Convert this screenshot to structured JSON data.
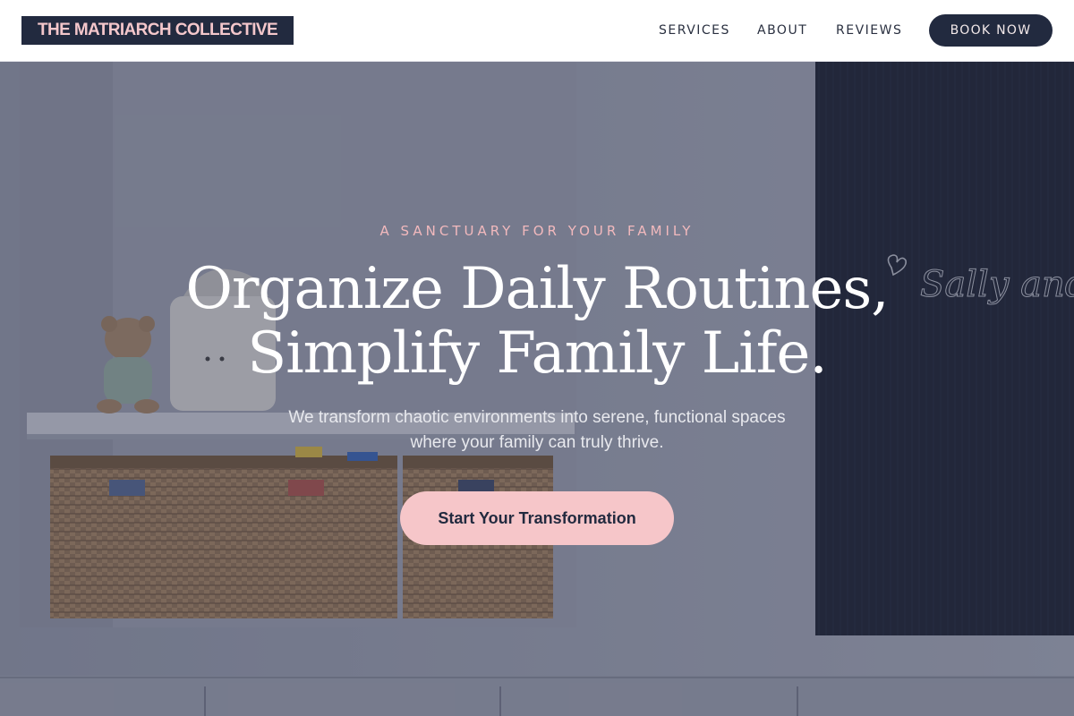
{
  "header": {
    "logo_text": "THE MATRIARCH COLLECTIVE",
    "nav": {
      "services": "SERVICES",
      "about": "ABOUT",
      "reviews": "REVIEWS"
    },
    "cta_label": "BOOK NOW"
  },
  "hero": {
    "eyebrow": "A SANCTUARY FOR YOUR FAMILY",
    "headline_line1": "Organize Daily Routines,",
    "headline_line2": "Simplify Family Life.",
    "subtext_line1": "We transform chaotic environments into serene, functional spaces",
    "subtext_line2": "where your family can truly thrive.",
    "cta_label": "Start Your Transformation",
    "chalkboard_text": "Sally and"
  },
  "colors": {
    "navy": "#222a3f",
    "blush": "#f6c6c9",
    "eyebrow_pink": "#f2b9bd",
    "white": "#ffffff"
  },
  "icons": {
    "chalkboard_heart": "heart-icon"
  }
}
